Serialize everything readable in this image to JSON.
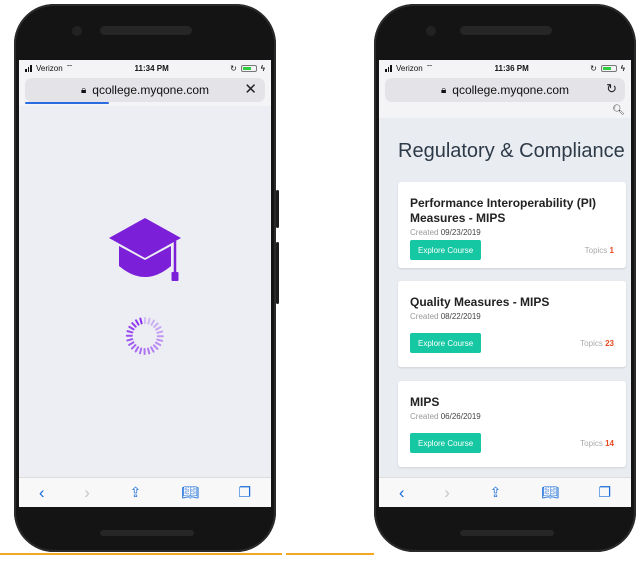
{
  "colors": {
    "accent_purple": "#7b1fd8",
    "link_blue": "#1a6ddc",
    "button_teal": "#15c7a2",
    "topics_count": "#e8491d"
  },
  "left_phone": {
    "status": {
      "carrier": "Verizon",
      "time": "11:34 PM"
    },
    "url": "qcollege.myqone.com",
    "url_action_icon": "close-icon",
    "loading_icon": "graduation-cap-icon",
    "page_load_progress": 0.35
  },
  "right_phone": {
    "status": {
      "carrier": "Verizon",
      "time": "11:36 PM"
    },
    "url": "qcollege.myqone.com",
    "url_action_icon": "reload-icon",
    "page_title": "Regulatory & Compliance",
    "courses": [
      {
        "title": "Performance Interoperability (PI) Measures - MIPS",
        "created_label": "Created",
        "created_date": "09/23/2019",
        "button_label": "Explore Course",
        "topics_label": "Topics",
        "topics_count": "1"
      },
      {
        "title": "Quality Measures - MIPS",
        "created_label": "Created",
        "created_date": "08/22/2019",
        "button_label": "Explore Course",
        "topics_label": "Topics",
        "topics_count": "23"
      },
      {
        "title": "MIPS",
        "created_label": "Created",
        "created_date": "06/26/2019",
        "button_label": "Explore Course",
        "topics_label": "Topics",
        "topics_count": "14"
      }
    ]
  }
}
